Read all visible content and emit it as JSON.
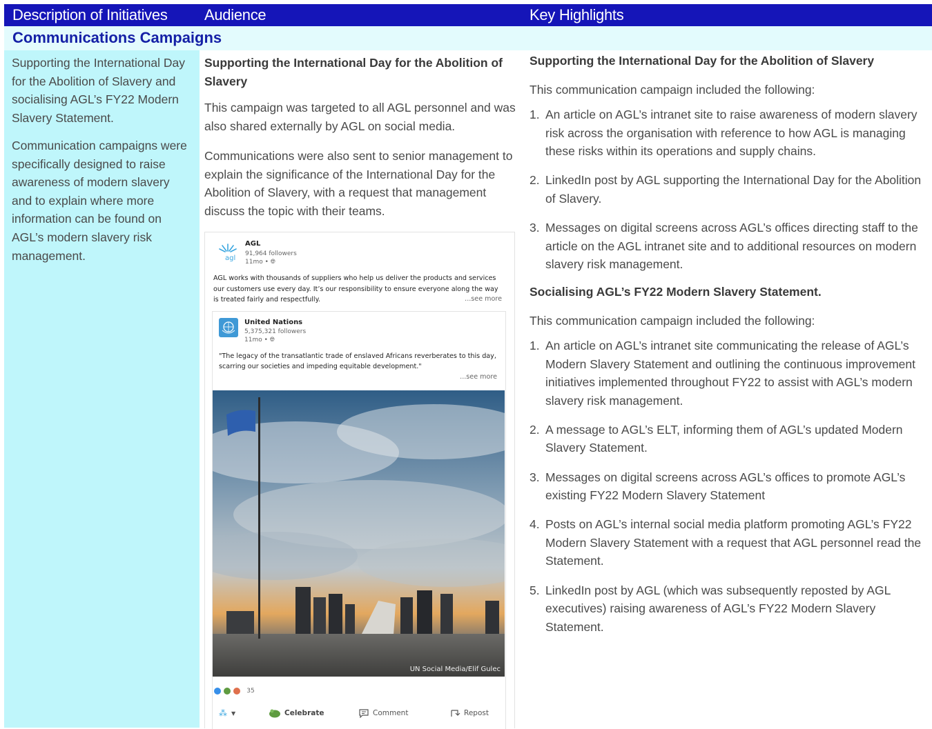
{
  "header": {
    "col1": "Description of Initiatives",
    "col2": "Audience",
    "col3": "Key Highlights"
  },
  "section": {
    "title": "Communications Campaigns"
  },
  "description": {
    "p1": "Supporting the International Day for the Abolition of Slavery and socialising AGL’s FY22 Modern Slavery Statement.",
    "p2": "Communication campaigns were specifically designed to raise awareness of modern slavery and to explain where more information can be found on AGL’s modern slavery risk management."
  },
  "audience": {
    "heading": "Supporting the International Day for the Abolition of Slavery",
    "p1": "This campaign was targeted to all AGL personnel and was also shared externally by AGL on social media.",
    "p2": "Communications were also sent to senior management to explain the significance of the International Day for the Abolition of Slavery, with a request that management discuss the topic with their teams."
  },
  "post": {
    "org": "AGL",
    "logo_text": "agl",
    "followers": "91,964 followers",
    "time": "11mo • ",
    "body": "AGL works with thousands of suppliers who help us deliver the products and services our customers use every day. It’s our responsibility to ensure everyone along the way is treated fairly and respectfully.",
    "see_more": "...see more",
    "shared": {
      "org": "United Nations",
      "followers": "5,375,321 followers",
      "time": "11mo • ",
      "quote": "\"The legacy of the transatlantic trade of enslaved Africans reverberates to this day, scarring our societies and impeding equitable development.\"",
      "see_more": "...see more",
      "photo_credit": "UN Social Media/Elif Gulec"
    },
    "reaction_count": "35",
    "actions": {
      "celebrate": "Celebrate",
      "comment": "Comment",
      "repost": "Repost"
    }
  },
  "highlights": {
    "heading1": "Supporting the International Day for the Abolition of Slavery",
    "intro1": "This communication campaign included the following:",
    "list1": [
      {
        "num": "1.",
        "text": "An article on AGL’s intranet site to raise awareness of modern slavery risk across the organisation with reference to how AGL is managing these risks within its operations and supply chains."
      },
      {
        "num": "2.",
        "text": "LinkedIn post by AGL supporting the International Day for the Abolition of Slavery."
      },
      {
        "num": "3.",
        "text": "Messages on digital screens across AGL’s offices directing staff to the article on the AGL intranet site and to additional resources on modern slavery risk management."
      }
    ],
    "heading2": "Socialising AGL’s FY22 Modern Slavery Statement.",
    "intro2": "This communication campaign included the following:",
    "list2": [
      {
        "num": "1.",
        "text": "An article on AGL’s intranet site communicating the release of AGL’s Modern Slavery Statement and outlining the continuous improvement initiatives implemented throughout FY22 to assist with AGL’s modern slavery risk management."
      },
      {
        "num": "2.",
        "text": "A message to AGL’s ELT, informing them of AGL’s updated Modern Slavery Statement."
      },
      {
        "num": "3.",
        "text": "Messages on digital screens across AGL’s offices to promote AGL’s existing FY22 Modern Slavery Statement"
      },
      {
        "num": "4.",
        "text": "Posts on AGL’s internal social media platform promoting AGL’s FY22 Modern Slavery Statement with a request that AGL personnel read the Statement."
      },
      {
        "num": "5.",
        "text": "LinkedIn post by AGL (which was subsequently reposted by AGL executives) raising awareness of AGL’s FY22 Modern Slavery Statement."
      }
    ]
  },
  "colors": {
    "header_bg": "#1515b8",
    "section_bg": "#e3fbfd",
    "section_text": "#1520a6",
    "left_col_bg": "#bff6fb"
  }
}
